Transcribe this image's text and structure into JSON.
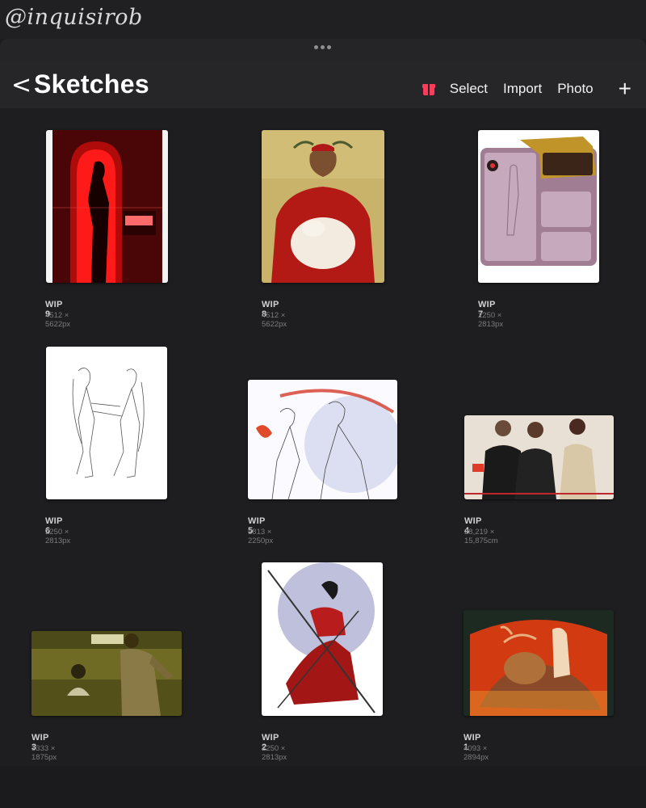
{
  "watermark": "@inquisirob",
  "header": {
    "back_glyph": "<",
    "title": "Sketches",
    "gift_icon": "gift-icon",
    "select_label": "Select",
    "import_label": "Import",
    "photo_label": "Photo",
    "add_glyph": "+"
  },
  "colors": {
    "accent_gift": "#ff3b5c",
    "background": "#1e1e20",
    "text_primary": "#ffffff",
    "text_secondary": "#7c7c80"
  },
  "artworks": [
    {
      "name": "WIP 9",
      "dimensions": "4512 × 5622px"
    },
    {
      "name": "WIP 8",
      "dimensions": "4512 × 5622px"
    },
    {
      "name": "WIP 7",
      "dimensions": "2250 × 2813px"
    },
    {
      "name": "WIP 6",
      "dimensions": "2250 × 2813px"
    },
    {
      "name": "WIP 5",
      "dimensions": "2813 × 2250px"
    },
    {
      "name": "WIP 4",
      "dimensions": "28,219 × 15,875cm"
    },
    {
      "name": "WIP 3",
      "dimensions": "3333 × 1875px"
    },
    {
      "name": "WIP 2",
      "dimensions": "2250 × 2813px"
    },
    {
      "name": "WIP 1",
      "dimensions": "4093 × 2894px"
    }
  ]
}
